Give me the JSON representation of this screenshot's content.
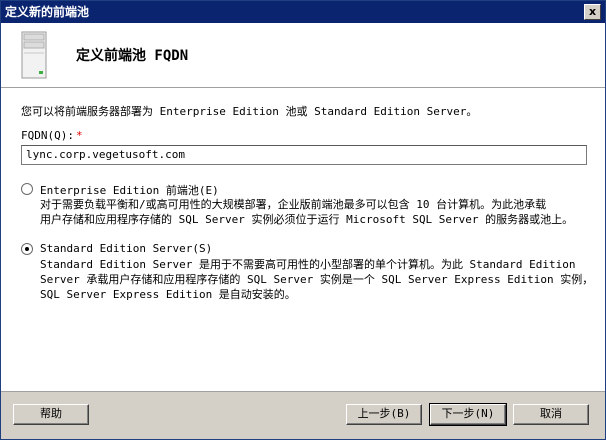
{
  "window": {
    "title": "定义新的前端池",
    "close_label": "x"
  },
  "header": {
    "title": "定义前端池 FQDN"
  },
  "main": {
    "intro": "您可以将前端服务器部署为 Enterprise Edition 池或 Standard Edition Server。",
    "fqdn_label": "FQDN(Q):",
    "fqdn_required_mark": "*",
    "fqdn_value": "lync.corp.vegetusoft.com",
    "options": [
      {
        "label": "Enterprise Edition 前端池(E)",
        "checked": false,
        "description_lines": [
          "对于需要负载平衡和/或高可用性的大规模部署，企业版前端池最多可以包含 10 台计算机。为此池承载",
          "用户存储和应用程序存储的 SQL Server 实例必须位于运行 Microsoft SQL Server 的服务器或池上。"
        ]
      },
      {
        "label": "Standard Edition Server(S)",
        "checked": true,
        "description_lines": [
          "Standard Edition Server 是用于不需要高可用性的小型部署的单个计算机。为此 Standard Edition",
          "Server 承载用户存储和应用程序存储的 SQL Server 实例是一个 SQL Server Express Edition 实例，",
          "SQL Server Express Edition 是自动安装的。"
        ]
      }
    ]
  },
  "footer": {
    "help_label": "帮助",
    "back_label": "上一步(B)",
    "next_label": "下一步(N)",
    "cancel_label": "取消"
  },
  "colors": {
    "titlebar_bg": "#0a2470",
    "required_mark": "#e00000",
    "footer_bg": "#d4d0c8"
  }
}
